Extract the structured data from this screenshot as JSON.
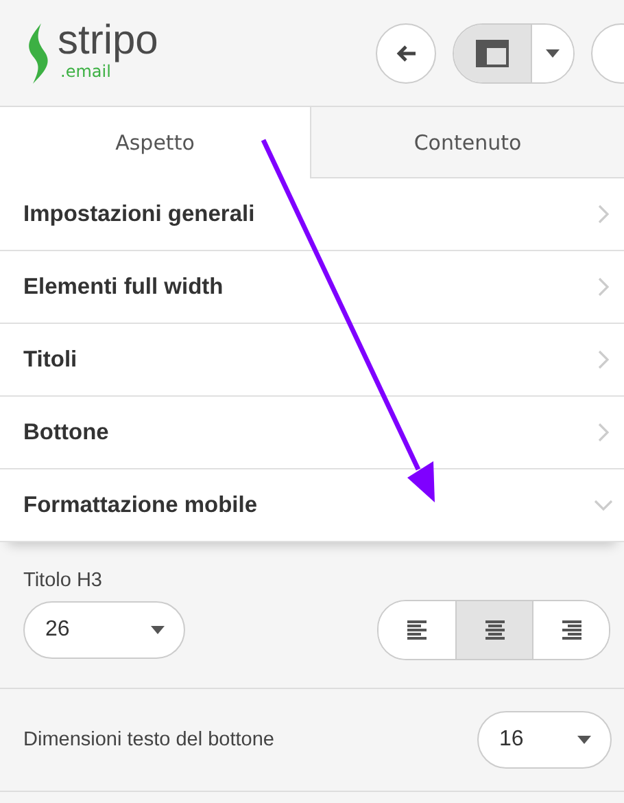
{
  "logo": {
    "name": "stripo",
    "suffix": ".email"
  },
  "toolbar": {
    "layout_view": {
      "selected": true
    }
  },
  "tabs": [
    {
      "label": "Aspetto",
      "selected": true
    },
    {
      "label": "Contenuto",
      "selected": false
    }
  ],
  "sections": [
    {
      "label": "Impostazioni generali",
      "expanded": false
    },
    {
      "label": "Elementi full width",
      "expanded": false
    },
    {
      "label": "Titoli",
      "expanded": false
    },
    {
      "label": "Bottone",
      "expanded": false
    },
    {
      "label": "Formattazione mobile",
      "expanded": true
    }
  ],
  "mobile_settings": {
    "heading_label": "Titolo H3",
    "heading_size": "26",
    "alignment": [
      {
        "kind": "left",
        "selected": false
      },
      {
        "kind": "center",
        "selected": true
      },
      {
        "kind": "right",
        "selected": false
      }
    ],
    "button_text_label": "Dimensioni testo del bottone",
    "button_text_size": "16"
  }
}
